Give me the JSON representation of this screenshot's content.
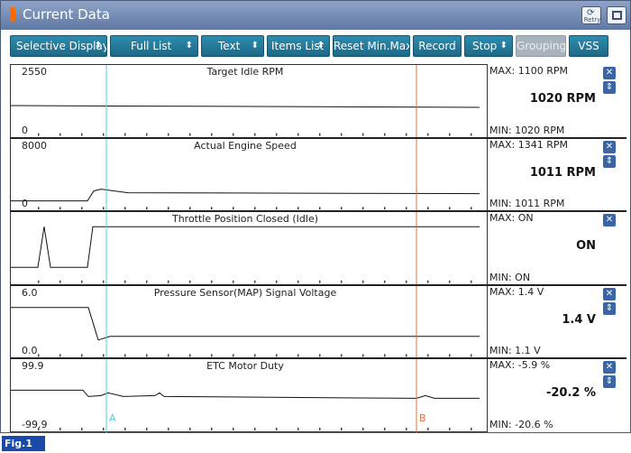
{
  "window": {
    "title": "Current Data",
    "retry_label": "Retry"
  },
  "toolbar": {
    "buttons": [
      {
        "label": "Selective Display",
        "has_arrow": true
      },
      {
        "label": "Full List",
        "has_arrow": true
      },
      {
        "label": "Text",
        "has_arrow": true
      },
      {
        "label": "Items List",
        "has_arrow": true
      },
      {
        "label": "Reset Min.Max",
        "has_arrow": false
      },
      {
        "label": "Record",
        "has_arrow": false
      },
      {
        "label": "Stop",
        "has_arrow": true
      },
      {
        "label": "Grouping",
        "has_arrow": false,
        "disabled": true
      },
      {
        "label": "VSS",
        "has_arrow": false
      }
    ]
  },
  "colors": {
    "cursor_a": "#4fd3e0",
    "cursor_b": "#e0703a",
    "toolbar_btn": "#1f7596",
    "close_btn": "#3a66a8"
  },
  "cursors": {
    "a_label": "A",
    "b_label": "B"
  },
  "panels": [
    {
      "title": "Target Idle RPM",
      "ymax_label": "2550",
      "ymin_label": "0",
      "max": "MAX:  1100 RPM",
      "min": "MIN:  1020 RPM",
      "current": "1020 RPM",
      "has_scroll": true
    },
    {
      "title": "Actual Engine Speed",
      "ymax_label": "8000",
      "ymin_label": "0",
      "max": "MAX:  1341 RPM",
      "min": "MIN:  1011 RPM",
      "current": "1011 RPM",
      "has_scroll": true
    },
    {
      "title": "Throttle Position Closed (Idle)",
      "ymax_label": "",
      "ymin_label": "",
      "max": "MAX: ON",
      "min": "MIN: ON",
      "current": "ON",
      "has_scroll": false
    },
    {
      "title": "Pressure Sensor(MAP) Signal Voltage",
      "ymax_label": "6.0",
      "ymin_label": "0.0",
      "max": "MAX:   1.4 V",
      "min": "MIN:   1.1 V",
      "current": "1.4  V",
      "has_scroll": true
    },
    {
      "title": "ETC Motor Duty",
      "ymax_label": "99.9",
      "ymin_label": "-99.9",
      "max": "MAX:  -5.9 %",
      "min": "MIN: -20.6 %",
      "current": "-20.2 %",
      "has_scroll": true
    }
  ],
  "figure_label": "Fig.1"
}
